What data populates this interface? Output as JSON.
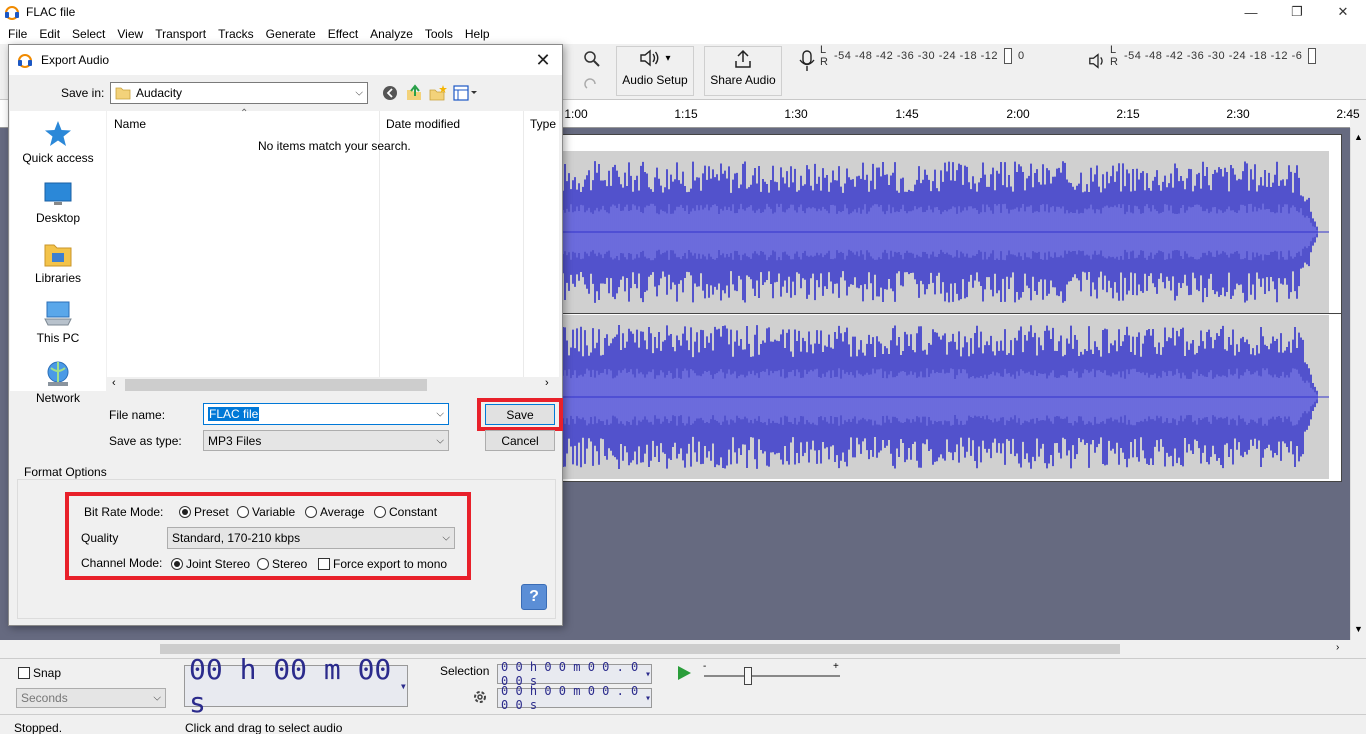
{
  "window": {
    "title": "FLAC file",
    "minimize": "—",
    "restore": "❐",
    "close": "✕"
  },
  "menu": [
    "File",
    "Edit",
    "Select",
    "View",
    "Transport",
    "Tracks",
    "Generate",
    "Effect",
    "Analyze",
    "Tools",
    "Help"
  ],
  "toolbar": {
    "audio_setup": "Audio Setup",
    "audio_setup_caret": "▾",
    "share_audio": "Share Audio",
    "record_meter_L": "L",
    "record_meter_R": "R",
    "meter_scale": "-54 -48 -42 -36 -30 -24 -18 -12",
    "meter_zero": "0",
    "play_meter_scale": "-54 -48 -42 -36 -30 -24 -18 -12 -6"
  },
  "ruler": {
    "labels": [
      "1:00",
      "1:15",
      "1:30",
      "1:45",
      "2:00",
      "2:15",
      "2:30",
      "2:45"
    ]
  },
  "dialog": {
    "title": "Export Audio",
    "close": "✕",
    "save_in_label": "Save in:",
    "save_in_value": "Audacity",
    "places": [
      "Quick access",
      "Desktop",
      "Libraries",
      "This PC",
      "Network"
    ],
    "columns": {
      "name": "Name",
      "date_modified": "Date modified",
      "type": "Type"
    },
    "empty_message": "No items match your search.",
    "file_name_label": "File name:",
    "file_name_value": "FLAC file",
    "save_as_type_label": "Save as type:",
    "save_as_type_value": "MP3 Files",
    "save_button": "Save",
    "cancel_button": "Cancel",
    "format_options": {
      "group_label": "Format Options",
      "bit_rate_mode_label": "Bit Rate Mode:",
      "bit_rate_modes": [
        "Preset",
        "Variable",
        "Average",
        "Constant"
      ],
      "bit_rate_selected": "Preset",
      "quality_label": "Quality",
      "quality_value": "Standard, 170-210 kbps",
      "channel_mode_label": "Channel Mode:",
      "channel_modes": [
        "Joint Stereo",
        "Stereo"
      ],
      "channel_selected": "Joint Stereo",
      "force_mono_label": "Force export to mono",
      "force_mono_checked": false
    },
    "help_label": "?"
  },
  "bottom": {
    "snap_label": "Snap",
    "snap_unit": "Seconds",
    "time_display": "00 h 00 m 00 s",
    "selection_label": "Selection",
    "selection_start": "0 0 h 0 0 m 0 0 . 0 0 0 s",
    "selection_end": "0 0 h 0 0 m 0 0 . 0 0 0 s",
    "speed_minus": "-",
    "speed_plus": "+"
  },
  "status": {
    "state": "Stopped.",
    "hint": "Click and drag to select audio"
  },
  "colors": {
    "waveform": "#3333cc",
    "waveform_rms": "#6a6ae0",
    "track_bg": "#d0d0d0",
    "highlight": "#e8202a",
    "selected_text_bg": "#0078d7"
  }
}
